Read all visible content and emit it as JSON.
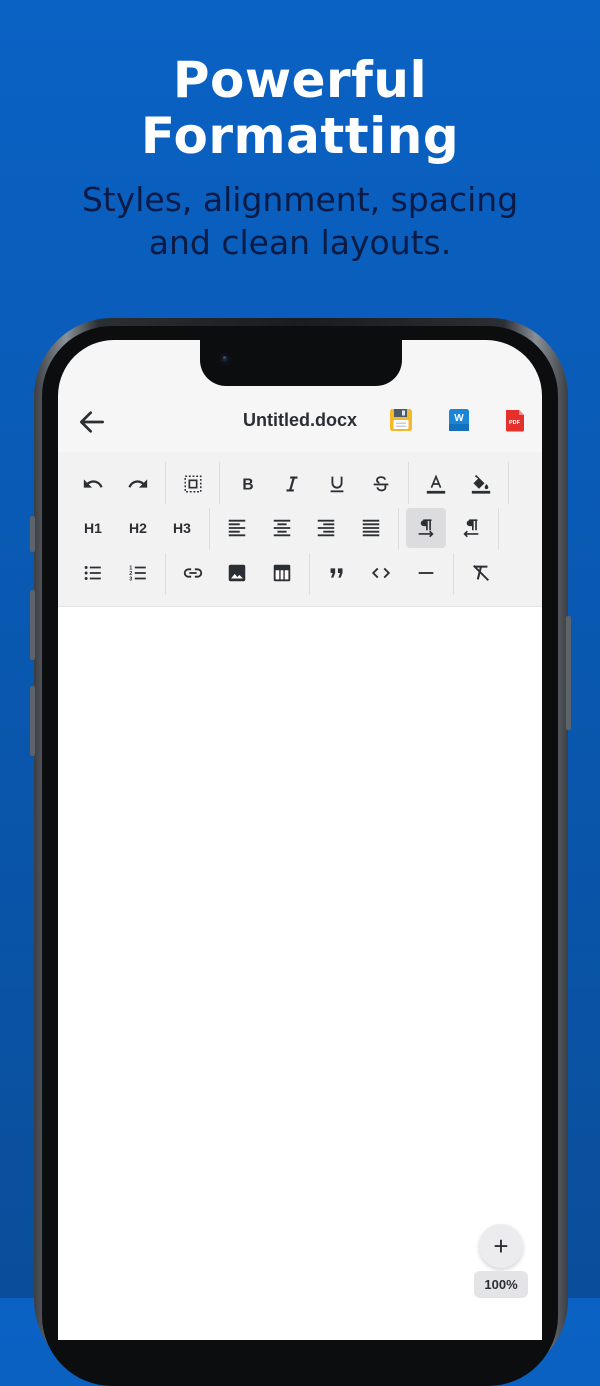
{
  "headline": [
    "Powerful",
    "Formatting"
  ],
  "subline": [
    "Styles, alignment, spacing",
    "and clean layouts."
  ],
  "appbar": {
    "title": "Untitled.docx",
    "save_icon": "floppy-disk-icon",
    "word_icon": "word-export-icon",
    "word_icon_letter": "W",
    "pdf_icon": "pdf-export-icon",
    "pdf_icon_text": "PDF"
  },
  "toolbar": {
    "heading1": "H1",
    "heading2": "H2",
    "heading3": "H3"
  },
  "zoom": {
    "label": "100%"
  },
  "fab": {
    "symbol": "+"
  },
  "colors": {
    "background_top": "#0a62c4",
    "background_bottom": "#0a4e9a",
    "headline": "#ffffff",
    "subline": "#0b1b45",
    "toolbar_bg": "#f2f2f3",
    "active_button": "#dcdcde"
  }
}
